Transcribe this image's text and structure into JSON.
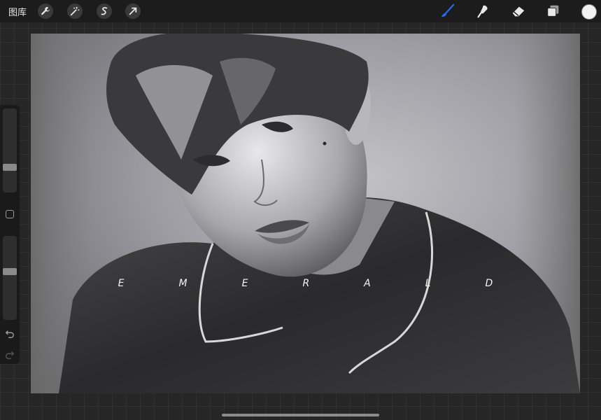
{
  "toolbar": {
    "gallery_label": "图库",
    "left_tools": [
      "wrench-icon",
      "magic-wand-icon",
      "selection-icon",
      "transform-arrow-icon"
    ],
    "right_tools": [
      "brush-icon",
      "smudge-icon",
      "eraser-icon",
      "layers-icon"
    ],
    "active_tool": "brush",
    "active_color": "#1e6ff5",
    "current_color": "#f2f2f2"
  },
  "sidebar": {
    "brush_size_level": 0.28,
    "opacity_level": 0.58
  },
  "canvas": {
    "caption": "EMERALD"
  }
}
